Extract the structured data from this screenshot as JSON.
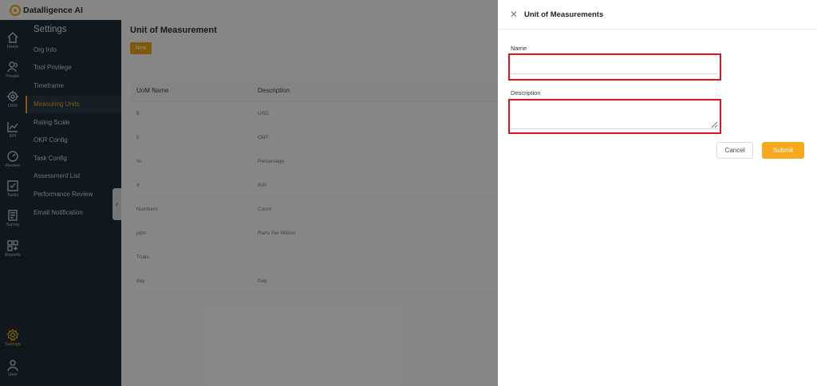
{
  "app": {
    "brand": "Datalligence AI"
  },
  "rail": [
    {
      "label": "Home",
      "icon": "home-icon"
    },
    {
      "label": "People",
      "icon": "people-icon"
    },
    {
      "label": "OKR",
      "icon": "target-icon"
    },
    {
      "label": "KPI",
      "icon": "chart-icon"
    },
    {
      "label": "Review",
      "icon": "gauge-icon"
    },
    {
      "label": "Tasks",
      "icon": "checkbox-icon"
    },
    {
      "label": "Survey",
      "icon": "survey-icon"
    },
    {
      "label": "Reports",
      "icon": "reports-icon"
    },
    {
      "label": "Settings",
      "icon": "gear-icon",
      "active": true
    },
    {
      "label": "User",
      "icon": "user-icon"
    }
  ],
  "settings": {
    "title": "Settings",
    "items": [
      {
        "label": "Org Info"
      },
      {
        "label": "Tool Privilege"
      },
      {
        "label": "Timeframe"
      },
      {
        "label": "Measuring Units",
        "active": true
      },
      {
        "label": "Rating Scale"
      },
      {
        "label": "OKR Config"
      },
      {
        "label": "Task Config"
      },
      {
        "label": "Assessment List"
      },
      {
        "label": "Performance Review"
      },
      {
        "label": "Email Notification"
      }
    ]
  },
  "main": {
    "title": "Unit of Measurement",
    "new_label": "New",
    "columns": [
      "UoM Name",
      "Description"
    ],
    "rows": [
      [
        "$",
        "USD"
      ],
      [
        "£",
        "GBP"
      ],
      [
        "%",
        "Percentage"
      ],
      [
        "₹",
        "INR"
      ],
      [
        "Numbers",
        "Count"
      ],
      [
        "ppm",
        "Parts Per Million"
      ],
      [
        "Trials",
        ""
      ],
      [
        "day",
        "Day"
      ]
    ]
  },
  "drawer": {
    "title": "Unit of Measurements",
    "name_label": "Name",
    "name_value": "",
    "description_label": "Description",
    "description_value": "",
    "cancel_label": "Cancel",
    "submit_label": "Submit"
  },
  "colors": {
    "accent": "#e8a317",
    "submit": "#f7a81b",
    "sidebar_bg": "#1e2b35",
    "highlight": "#e0141e"
  }
}
